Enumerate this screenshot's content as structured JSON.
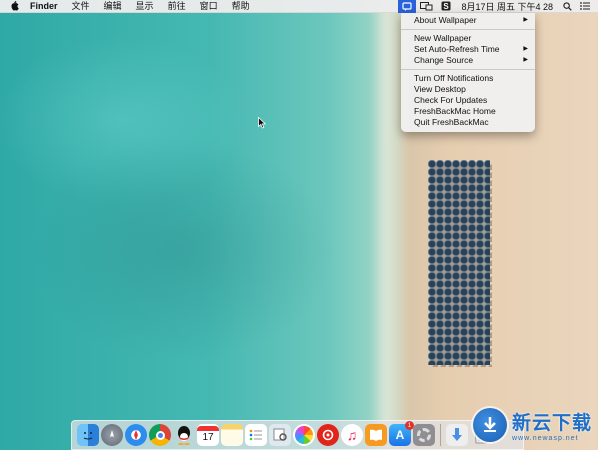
{
  "menubar": {
    "app_name": "Finder",
    "menus": [
      "文件",
      "编辑",
      "显示",
      "前往",
      "窗口",
      "帮助"
    ],
    "clock": "8月17日 周五 下午4 28",
    "status_icons": [
      "freshback-menu-icon",
      "display-mirroring-icon",
      "s-app-icon"
    ]
  },
  "dropdown": {
    "items": [
      {
        "label": "About Wallpaper",
        "submenu": true
      },
      {
        "label": "New Wallpaper",
        "submenu": false
      },
      {
        "label": "Set Auto-Refresh Time",
        "submenu": true
      },
      {
        "label": "Change Source",
        "submenu": true
      },
      {
        "label": "Turn Off Notifications",
        "submenu": false
      },
      {
        "label": "View Desktop",
        "submenu": false
      },
      {
        "label": "Check For Updates",
        "submenu": false
      },
      {
        "label": "FreshBackMac Home",
        "submenu": false
      },
      {
        "label": "Quit FreshBackMac",
        "submenu": false
      }
    ]
  },
  "dock": {
    "apps": [
      "finder",
      "launchpad",
      "safari",
      "chrome",
      "qq",
      "calendar",
      "notes",
      "reminders",
      "preview",
      "photos",
      "netease-music",
      "itunes",
      "ibooks",
      "app-store",
      "system-preferences"
    ],
    "app_store_badge": "1"
  },
  "watermark": {
    "title": "新云下载",
    "url": "www.newasp.net"
  },
  "colors": {
    "menu_highlight": "#2a62d9",
    "watermark_blue": "#1f6fc9"
  }
}
